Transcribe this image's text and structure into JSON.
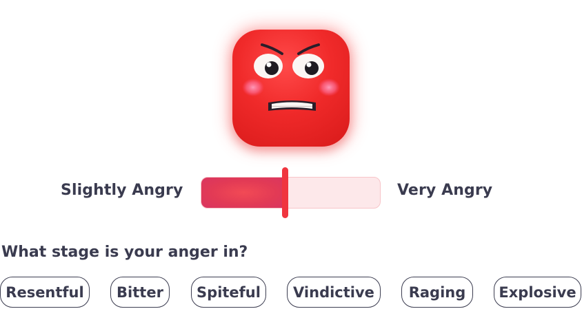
{
  "mood": {
    "emoji_icon": "angry-face-icon",
    "accent_color": "#f0353f",
    "scale_min_label": "Slightly Angry",
    "scale_max_label": "Very Angry",
    "level": 0.47
  },
  "question": {
    "text": "What stage is your anger in?"
  },
  "options": [
    {
      "label": "Resentful"
    },
    {
      "label": "Bitter"
    },
    {
      "label": "Spiteful"
    },
    {
      "label": "Vindictive"
    },
    {
      "label": "Raging"
    },
    {
      "label": "Explosive"
    }
  ]
}
